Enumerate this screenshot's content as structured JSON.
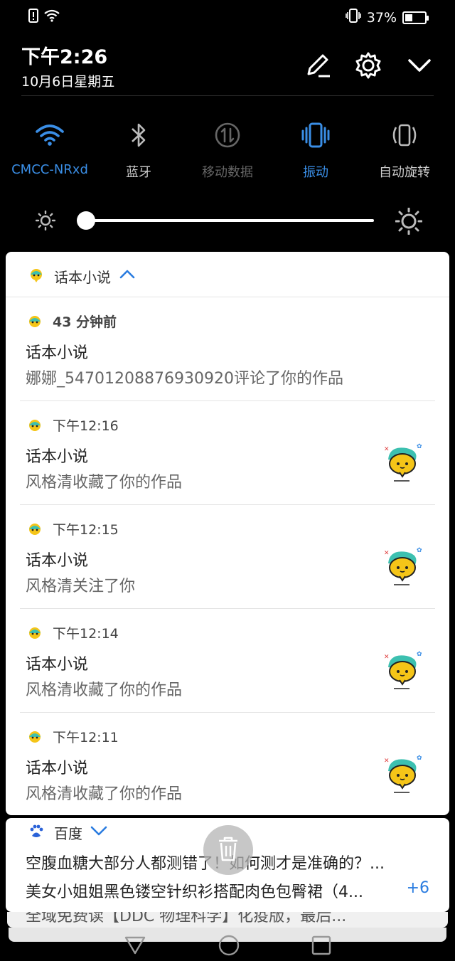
{
  "status_bar": {
    "battery_percent": "37%",
    "battery_level": 0.37
  },
  "header": {
    "time": "下午2:26",
    "date": "10月6日星期五",
    "icons": [
      "edit-icon",
      "gear-icon",
      "chevron-down-icon"
    ]
  },
  "quick_toggles": [
    {
      "label": "CMCC-NRxd",
      "icon": "wifi-icon",
      "state": "active"
    },
    {
      "label": "蓝牙",
      "icon": "bluetooth-icon",
      "state": "off"
    },
    {
      "label": "移动数据",
      "icon": "mobile-data-icon",
      "state": "disabled"
    },
    {
      "label": "振动",
      "icon": "vibrate-icon",
      "state": "active"
    },
    {
      "label": "自动旋转",
      "icon": "auto-rotate-icon",
      "state": "off"
    }
  ],
  "brightness": {
    "level": 0.0
  },
  "notification_group": {
    "app_name": "话本小说",
    "items": [
      {
        "time": "43 分钟前",
        "title": "话本小说",
        "text": "娜娜_54701208876930920评论了你的作品",
        "has_thumb": false
      },
      {
        "time": "下午12:16",
        "title": "话本小说",
        "text": "风格清收藏了你的作品",
        "has_thumb": true
      },
      {
        "time": "下午12:15",
        "title": "话本小说",
        "text": "风格清关注了你",
        "has_thumb": true
      },
      {
        "time": "下午12:14",
        "title": "话本小说",
        "text": "风格清收藏了你的作品",
        "has_thumb": true
      },
      {
        "time": "下午12:11",
        "title": "话本小说",
        "text": "风格清收藏了你的作品",
        "has_thumb": true
      }
    ]
  },
  "baidu_group": {
    "app_name": "百度",
    "line1": "空腹血糖大部分人都测错了！如何测才是准确的？...",
    "line2": "美女小姐姐黑色镂空针织衫搭配肉色包臀裙（4...",
    "more_count": "+6",
    "faded_line": "全域免费读【DDC 物理科学】化疫版，最后..."
  },
  "colors": {
    "accent": "#3a8ee6",
    "background": "#000000",
    "card": "#ffffff"
  }
}
